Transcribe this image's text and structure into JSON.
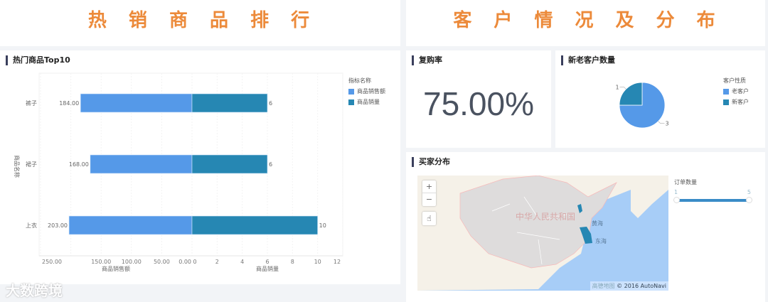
{
  "left_header": {
    "title": "热 销 商 品 排 行"
  },
  "right_header": {
    "title": "客 户 情 况 及 分 布"
  },
  "colors": {
    "accent": "#ec8a3a",
    "sales": "#5599e8",
    "qty": "#2687b3"
  },
  "chart_data": [
    {
      "type": "bar",
      "title": "热门商品Top10",
      "ylabel": "商品名称",
      "categories": [
        "裤子",
        "裙子",
        "上衣"
      ],
      "series": [
        {
          "name": "商品销售额",
          "values": [
            184,
            168,
            203
          ],
          "labels": [
            "184.00",
            "168.00",
            "203.00"
          ],
          "xlabel": "商品销售额",
          "xlim": [
            0,
            250
          ],
          "ticks": [
            "250.00",
            "150.00",
            "100.00",
            "50.00",
            "0.00"
          ]
        },
        {
          "name": "商品销量",
          "values": [
            6,
            6,
            10
          ],
          "labels": [
            "6",
            "6",
            "10"
          ],
          "xlabel": "商品销量",
          "xlim": [
            0,
            12
          ],
          "ticks": [
            "0",
            "2",
            "4",
            "6",
            "8",
            "10",
            "12"
          ]
        }
      ],
      "legend_title": "指标名称",
      "legend": "top-right"
    },
    {
      "type": "pie",
      "title": "新老客户数量",
      "legend_title": "客户性质",
      "slices": [
        {
          "name": "老客户",
          "value": 3
        },
        {
          "name": "新客户",
          "value": 1
        }
      ]
    }
  ],
  "repurchase": {
    "title": "复购率",
    "value": "75.00%"
  },
  "map": {
    "title": "买家分布",
    "zoom_in": "+",
    "zoom_out": "−",
    "labels": {
      "country": "中华人民共和国",
      "sea1": "黄海",
      "sea2": "东海"
    },
    "attribution_logo": "高德地图",
    "attribution": "© 2016 AutoNavi",
    "legend_title": "订单数量",
    "legend_min": "1",
    "legend_max": "5"
  },
  "watermark": "大数跨境"
}
